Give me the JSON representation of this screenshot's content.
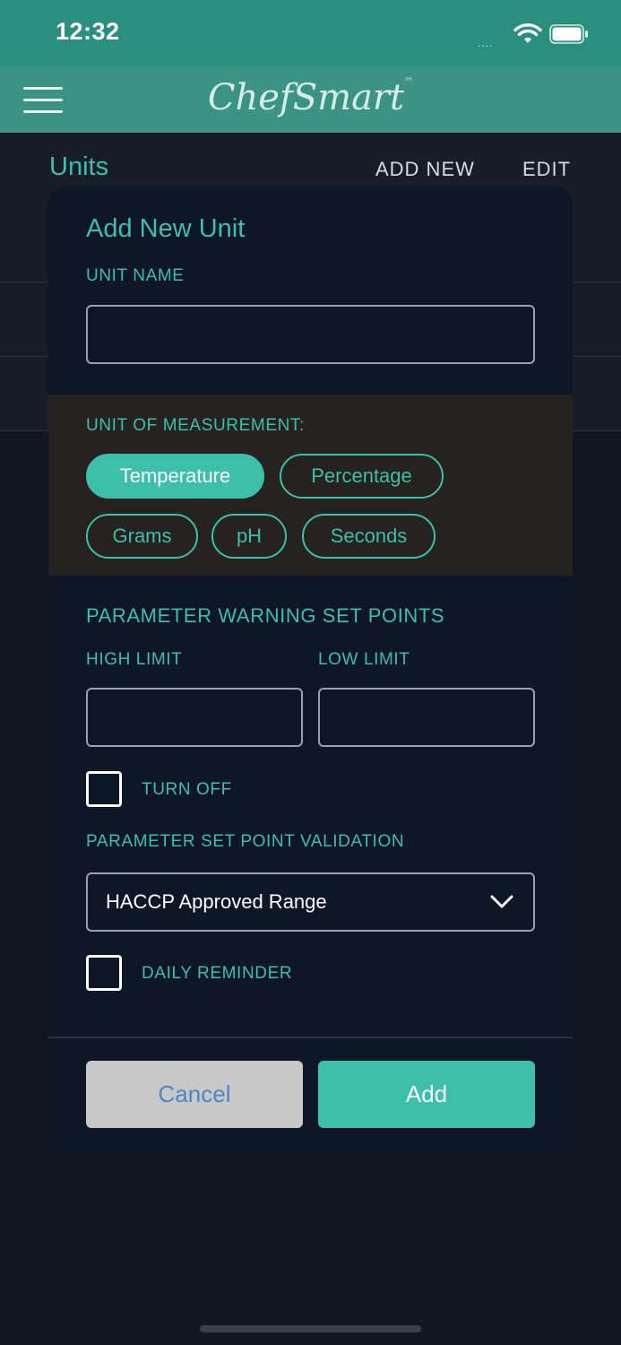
{
  "status_bar": {
    "time": "12:32",
    "signal": "....",
    "icons": [
      "wifi-icon",
      "battery-icon"
    ]
  },
  "app_bar": {
    "logo_main": "ChefSmart",
    "logo_tm": "™",
    "menu_icon": "hamburger-menu-icon"
  },
  "sub_bar": {
    "title": "Units",
    "add_new": "ADD NEW",
    "edit": "EDIT"
  },
  "modal": {
    "title": "Add New Unit",
    "unit_name_label": "UNIT NAME",
    "unit_name_value": "",
    "measurement_label": "UNIT OF MEASUREMENT:",
    "measurements": [
      {
        "label": "Temperature",
        "selected": true
      },
      {
        "label": "Percentage",
        "selected": false
      },
      {
        "label": "Grams",
        "selected": false
      },
      {
        "label": "pH",
        "selected": false
      },
      {
        "label": "Seconds",
        "selected": false
      }
    ],
    "warning_title": "PARAMETER WARNING SET POINTS",
    "high_limit_label": "HIGH LIMIT",
    "low_limit_label": "LOW LIMIT",
    "high_limit_value": "",
    "low_limit_value": "",
    "turn_off_label": "TURN OFF",
    "turn_off_checked": false,
    "validation_label": "PARAMETER SET POINT VALIDATION",
    "validation_value": "HACCP Approved Range",
    "daily_reminder_label": "DAILY REMINDER",
    "daily_reminder_checked": false,
    "cancel_label": "Cancel",
    "add_label": "Add"
  },
  "colors": {
    "accent": "#3dbfac",
    "header": "#3b9384",
    "status": "#2b8f80",
    "modal": "#0e1628",
    "band": "#26221f"
  }
}
